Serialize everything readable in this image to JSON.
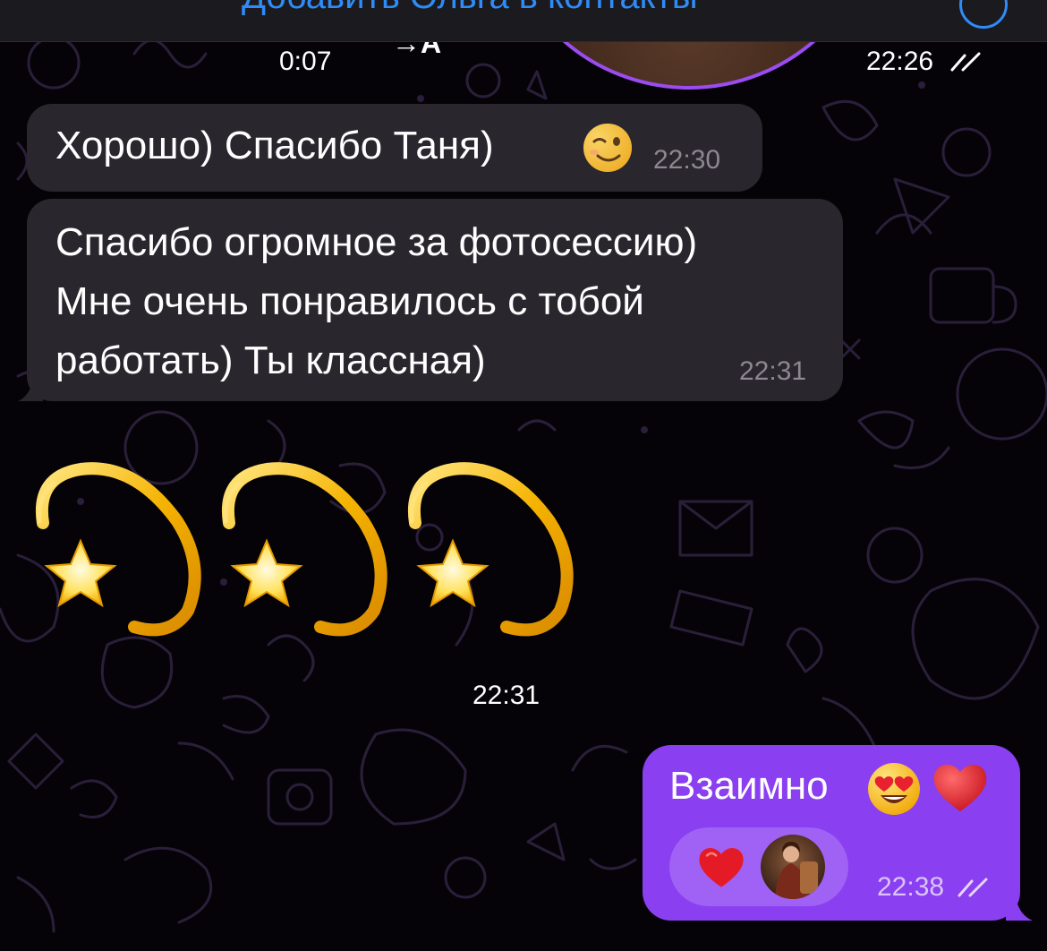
{
  "top_banner": {
    "text": "Добавить Ольга в контакты"
  },
  "video_message": {
    "duration": "0:07",
    "arrow_label": "→A",
    "time": "22:26",
    "status": "read"
  },
  "messages": [
    {
      "direction": "incoming",
      "lines": [
        "Хорошо) Спасибо Таня)"
      ],
      "emoji": "winking-face",
      "time": "22:30"
    },
    {
      "direction": "incoming",
      "lines": [
        "Спасибо огромное за фотосессию)",
        "Мне очень понравилось с тобой",
        "работать) Ты классная)"
      ],
      "time": "22:31"
    },
    {
      "direction": "incoming",
      "type": "emoji-only",
      "emoji": [
        "dizzy",
        "dizzy",
        "dizzy"
      ],
      "time": "22:31"
    },
    {
      "direction": "outgoing",
      "text": "Взаимно",
      "emoji": [
        "heart-eyes-face",
        "red-heart"
      ],
      "reaction": {
        "emoji": "red-heart",
        "reactor": "avatar"
      },
      "time": "22:38",
      "status": "read"
    }
  ],
  "colors": {
    "background": "#050307",
    "incoming_bubble": "#2a262e",
    "outgoing_bubble": "#8a3ff0",
    "reaction_pill": "#a062f5",
    "link_blue": "#2f8cf6",
    "timestamp_gray": "#8c8792"
  }
}
